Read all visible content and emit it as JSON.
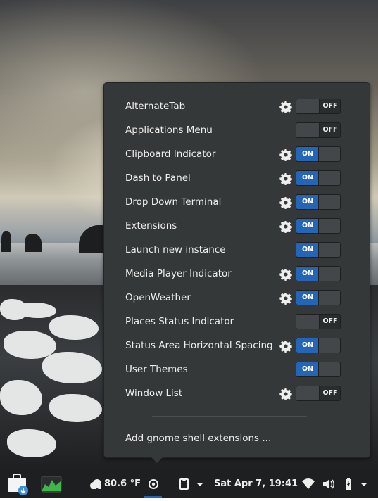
{
  "extensions": [
    {
      "name": "AlternateTab",
      "has_settings": true,
      "state": "OFF"
    },
    {
      "name": "Applications Menu",
      "has_settings": false,
      "state": "OFF"
    },
    {
      "name": "Clipboard Indicator",
      "has_settings": true,
      "state": "ON"
    },
    {
      "name": "Dash to Panel",
      "has_settings": true,
      "state": "ON"
    },
    {
      "name": "Drop Down Terminal",
      "has_settings": true,
      "state": "ON"
    },
    {
      "name": "Extensions",
      "has_settings": true,
      "state": "ON"
    },
    {
      "name": "Launch new instance",
      "has_settings": false,
      "state": "ON"
    },
    {
      "name": "Media Player Indicator",
      "has_settings": true,
      "state": "ON"
    },
    {
      "name": "OpenWeather",
      "has_settings": true,
      "state": "ON"
    },
    {
      "name": "Places Status Indicator",
      "has_settings": false,
      "state": "OFF"
    },
    {
      "name": "Status Area Horizontal Spacing",
      "has_settings": true,
      "state": "ON"
    },
    {
      "name": "User Themes",
      "has_settings": false,
      "state": "ON"
    },
    {
      "name": "Window List",
      "has_settings": true,
      "state": "OFF"
    }
  ],
  "add_link": "Add gnome shell extensions ...",
  "taskbar": {
    "weather": "80.6 °F",
    "clock": "Sat Apr  7, 19:41",
    "icons": [
      "software-store-icon",
      "system-monitor-icon",
      "weather-cloud-icon",
      "extensions-icon",
      "clipboard-icon",
      "chevron-down-icon",
      "wifi-icon",
      "volume-icon",
      "battery-icon",
      "system-menu-chevron-icon"
    ]
  },
  "colors": {
    "accent": "#2465b5",
    "popup_bg": "#353839",
    "taskbar_bg": "#1e1f20"
  }
}
